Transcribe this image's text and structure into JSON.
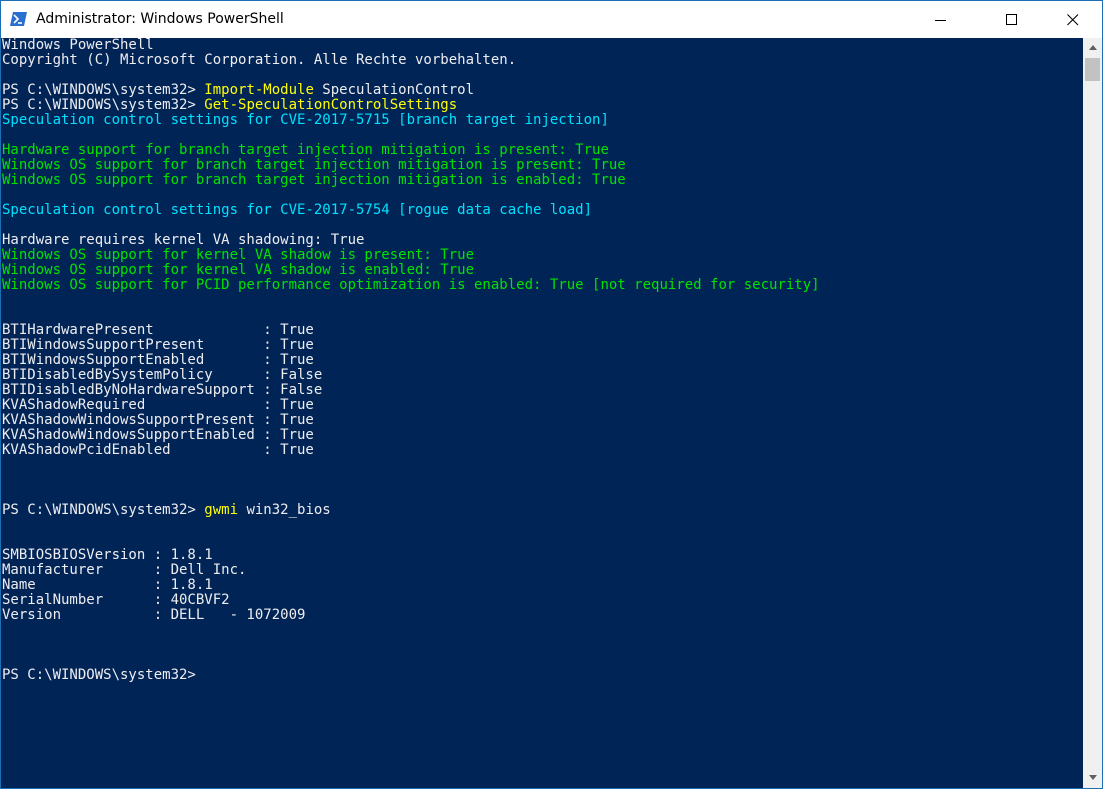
{
  "window": {
    "title": "Administrator: Windows PowerShell",
    "icon": "powershell-icon",
    "controls": [
      "minimize-icon",
      "maximize-icon",
      "close-icon"
    ]
  },
  "colors": {
    "console_background": "#012456",
    "default_text": "#eeedf0",
    "command_text": "#ffff00",
    "cyan_text": "#00e1ff",
    "green_text": "#00e200"
  },
  "console": {
    "header": [
      "Windows PowerShell",
      "Copyright (C) Microsoft Corporation. Alle Rechte vorbehalten."
    ],
    "prompt": "PS C:\\WINDOWS\\system32> ",
    "cmd1": "Import-Module",
    "cmd1_arg": " SpeculationControl",
    "cmd2": "Get-SpeculationControlSettings",
    "cve1_heading": "Speculation control settings for CVE-2017-5715 [branch target injection]",
    "cve1_lines": [
      "Hardware support for branch target injection mitigation is present: True",
      "Windows OS support for branch target injection mitigation is present: True",
      "Windows OS support for branch target injection mitigation is enabled: True"
    ],
    "cve2_heading": "Speculation control settings for CVE-2017-5754 [rogue data cache load]",
    "cve2_white_line": "Hardware requires kernel VA shadowing: True",
    "cve2_lines": [
      "Windows OS support for kernel VA shadow is present: True",
      "Windows OS support for kernel VA shadow is enabled: True",
      "Windows OS support for PCID performance optimization is enabled: True [not required for security]"
    ],
    "settings": [
      "BTIHardwarePresent             : True",
      "BTIWindowsSupportPresent       : True",
      "BTIWindowsSupportEnabled       : True",
      "BTIDisabledBySystemPolicy      : False",
      "BTIDisabledByNoHardwareSupport : False",
      "KVAShadowRequired              : True",
      "KVAShadowWindowsSupportPresent : True",
      "KVAShadowWindowsSupportEnabled : True",
      "KVAShadowPcidEnabled           : True"
    ],
    "cmd3": "gwmi",
    "cmd3_arg": " win32_bios",
    "bios": [
      "SMBIOSBIOSVersion : 1.8.1",
      "Manufacturer      : Dell Inc.",
      "Name              : 1.8.1",
      "SerialNumber      : 40CBVF2",
      "Version           : DELL   - 1072009"
    ]
  }
}
